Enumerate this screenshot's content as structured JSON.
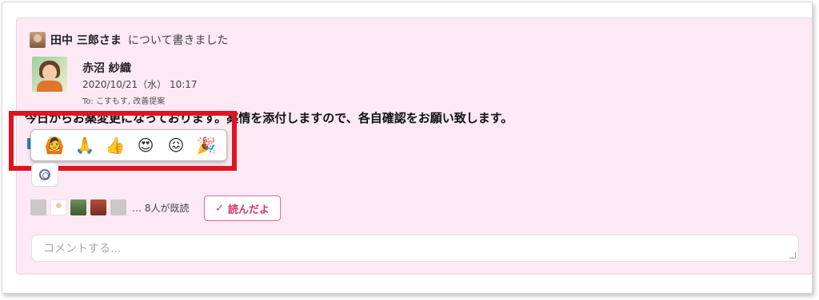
{
  "post": {
    "about": {
      "name": "田中 三郎さま",
      "suffix": "について書きました"
    },
    "author": {
      "name": "赤沼 紗織",
      "date": "2020/10/21（水） 10:17",
      "to": "To: こすもす, 改善提案"
    },
    "body": "今日からお薬変更になっております。薬情を添付しますので、各自確認をお願い致します。"
  },
  "reactions": {
    "items": [
      {
        "glyph": "🙆",
        "icon": "ok-gesture-icon"
      },
      {
        "glyph": "🙏",
        "icon": "praying-hands-icon"
      },
      {
        "glyph": "👍",
        "icon": "thumbs-up-icon"
      },
      {
        "glyph": "😍",
        "icon": "heart-eyes-icon"
      },
      {
        "glyph": "😖",
        "icon": "confounded-face-icon"
      },
      {
        "glyph": "🎉",
        "icon": "party-popper-icon"
      }
    ]
  },
  "readers": {
    "count_text": "… 8人が既読"
  },
  "read_button": {
    "check": "✓",
    "label": "読んだよ"
  },
  "comment": {
    "placeholder": "コメントする..."
  },
  "colors": {
    "card_bg": "#fce9f3",
    "highlight": "#e0131e",
    "accent_pink": "#e8629c"
  }
}
